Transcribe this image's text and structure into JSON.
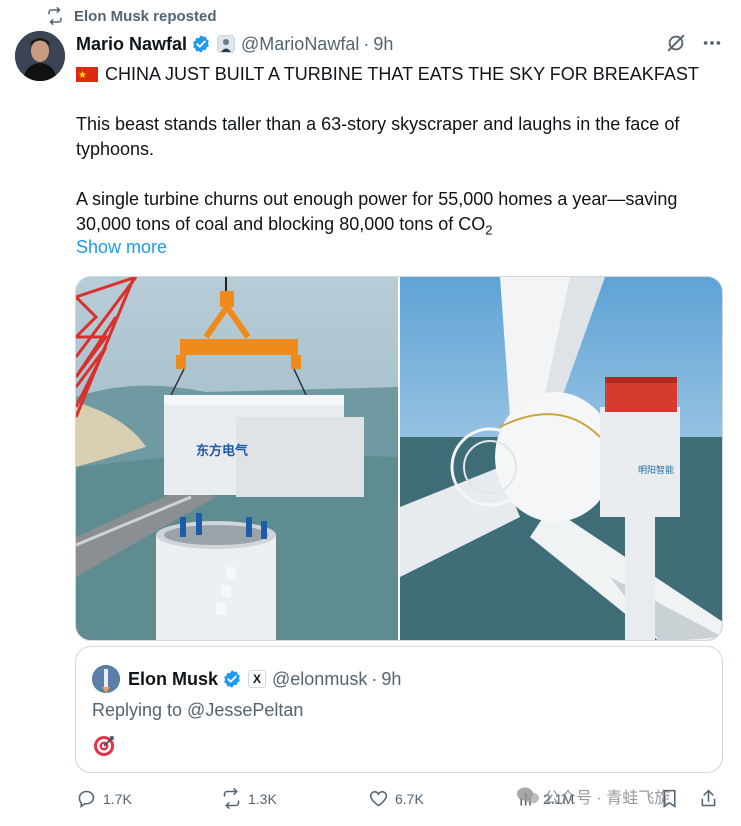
{
  "repost": {
    "label": "Elon Musk reposted",
    "icon": "repost-icon"
  },
  "tweet": {
    "author_name": "Mario Nawfal",
    "handle": "@MarioNawfal",
    "time": "9h",
    "separator": "·",
    "headline": "CHINA JUST BUILT A TURBINE THAT EATS THE SKY FOR BREAKFAST",
    "para1": "This beast stands taller than a 63-story skyscraper and laughs in the face of typhoons.",
    "para2_a": "A single turbine churns out enough power for 55,000 homes a year—saving 30,000 tons of coal and blocking 80,000 tons of CO",
    "para2_sub": "2",
    "show_more": "Show more",
    "logo_text_left": "东方电气",
    "logo_text_right": "明阳智能"
  },
  "quote": {
    "author_name": "Elon Musk",
    "badge": "X",
    "handle": "@elonmusk",
    "separator": "·",
    "time": "9h",
    "replying": "Replying to @JessePeltan",
    "emoji": "🎯"
  },
  "actions": {
    "replies": "1.7K",
    "reposts": "1.3K",
    "likes": "6.7K",
    "views": "2.1M"
  },
  "watermark": {
    "text": "公众号 · 青蛙飞旋"
  },
  "colors": {
    "accent": "#1d9bf0",
    "muted": "#536471",
    "text": "#0f1419",
    "border": "#cfd9de"
  }
}
